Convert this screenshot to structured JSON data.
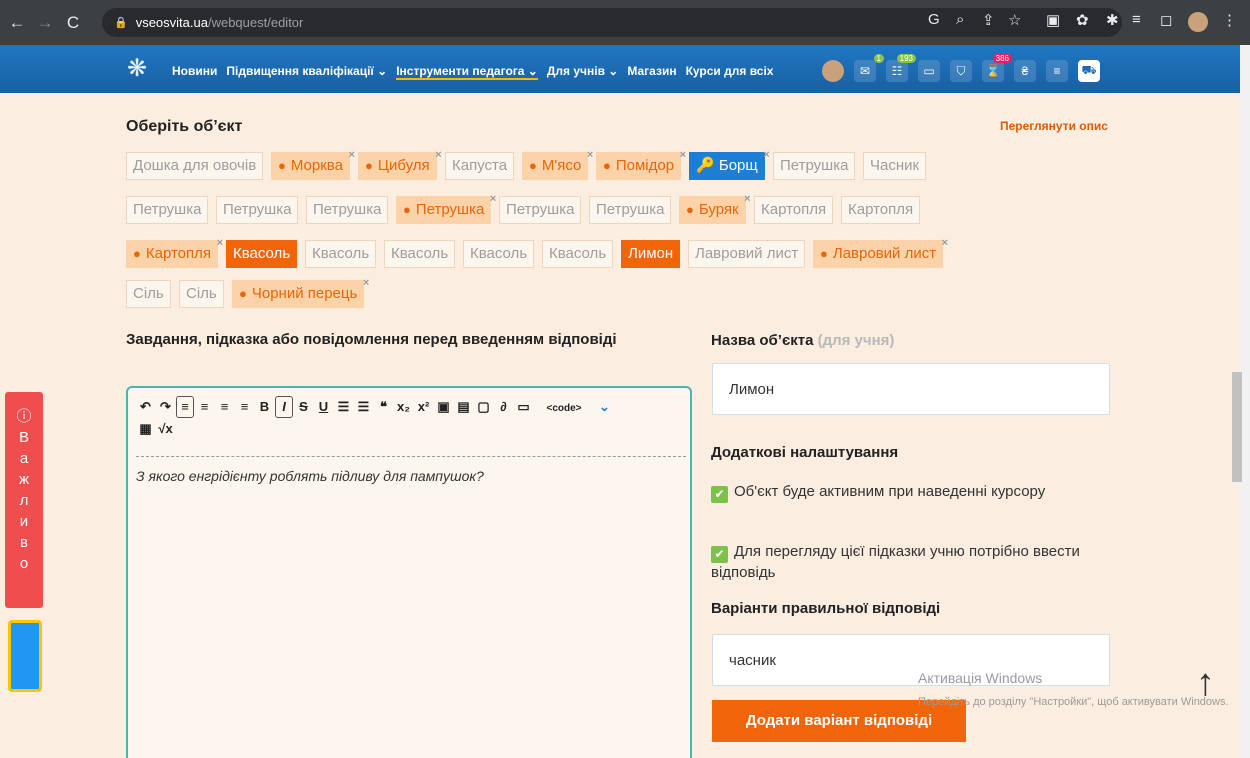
{
  "browser": {
    "url_domain": "vseosvita.ua",
    "url_path": "/webquest/editor"
  },
  "site_menu": [
    "Новини",
    "Підвищення кваліфікації ⌄",
    "Інструменти педагога ⌄",
    "Для учнів ⌄",
    "Магазин",
    "Курси для всіх"
  ],
  "badges": {
    "messages": "1",
    "comments": "193",
    "notifications": "386"
  },
  "objects_section": {
    "title": "Оберіть об’єкт",
    "view_desc": "Переглянути опис"
  },
  "chips": [
    {
      "label": "Дошка для овочів",
      "state": "plain"
    },
    {
      "label": "Морква",
      "state": "sel"
    },
    {
      "label": "Цибуля",
      "state": "sel"
    },
    {
      "label": "Капуста",
      "state": "plain"
    },
    {
      "label": "М'ясо",
      "state": "sel"
    },
    {
      "label": "Помідор",
      "state": "sel"
    },
    {
      "label": "Борщ",
      "state": "blue"
    },
    {
      "label": "Петрушка",
      "state": "plain"
    },
    {
      "label": "Часник",
      "state": "plain"
    },
    {
      "label": "Петрушка",
      "state": "plain"
    },
    {
      "label": "Петрушка",
      "state": "plain"
    },
    {
      "label": "Петрушка",
      "state": "plain"
    },
    {
      "label": "Петрушка",
      "state": "sel"
    },
    {
      "label": "Петрушка",
      "state": "plain"
    },
    {
      "label": "Петрушка",
      "state": "plain"
    },
    {
      "label": "Буряк",
      "state": "sel"
    },
    {
      "label": "Картопля",
      "state": "plain"
    },
    {
      "label": "Картопля",
      "state": "plain"
    },
    {
      "label": "Картопля",
      "state": "sel"
    },
    {
      "label": "Квасоль",
      "state": "hot"
    },
    {
      "label": "Квасоль",
      "state": "plain"
    },
    {
      "label": "Квасоль",
      "state": "plain"
    },
    {
      "label": "Квасоль",
      "state": "plain"
    },
    {
      "label": "Квасоль",
      "state": "plain"
    },
    {
      "label": "Лимон",
      "state": "hot"
    },
    {
      "label": "Лавровий лист",
      "state": "plain"
    },
    {
      "label": "Лавровий лист",
      "state": "sel"
    },
    {
      "label": "Сіль",
      "state": "plain"
    },
    {
      "label": "Сіль",
      "state": "plain"
    },
    {
      "label": "Чорний перець",
      "state": "sel"
    }
  ],
  "task": {
    "label": "Завдання, підказка або повідомлення перед введенням відповіді",
    "text": "З якого енгрідієнту роблять підливу для пампушок?"
  },
  "object_name": {
    "label": "Назва об’єкта",
    "hint": "(для учня)",
    "value": "Лимон"
  },
  "extra": {
    "label": "Додаткові налаштування",
    "opt1": "Об'єкт буде активним при наведенні курсору",
    "opt2": "Для перегляду цієї підказки учню потрібно ввести відповідь"
  },
  "answers": {
    "label": "Варіанти правильної відповіді",
    "value": "часник",
    "add_button": "Додати варіант відповіді"
  },
  "side_tab": "Важливо",
  "watermark": {
    "title": "Активація Windows",
    "text": "Перейдіть до розділу \"Настройки\", щоб активувати Windows."
  },
  "colors": {
    "accent": "#f0650a",
    "nav": "#1a6ab5",
    "selected_chip": "#fcd3a8",
    "check": "#7cc24a"
  }
}
